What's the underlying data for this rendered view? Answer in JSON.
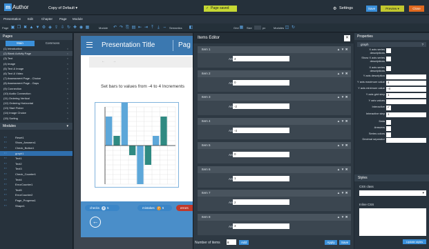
{
  "app": {
    "logo_letter": "m",
    "logo_text": "Author",
    "doc_title": "Copy of Default  ▾",
    "saved": "Page saved",
    "settings": "Settings",
    "save": "Save",
    "preview": "Preview ▾",
    "close": "Close"
  },
  "menu": [
    "Presentation",
    "Edit",
    "Chapter",
    "Page",
    "Module"
  ],
  "toolbar": {
    "page": "Page",
    "module": "Module",
    "semantics": "Semantics",
    "grid": "Grid",
    "size": "Size",
    "px": "px",
    "modules": "Modules"
  },
  "pages": {
    "title": "Pages",
    "tab_main": "Main",
    "tab_commons": "Commons",
    "items": [
      "(1) Introduction",
      "(2) Blank Activity Page",
      "(3) Text",
      "(4) Image",
      "(5) Text & Image",
      "(6) Text & Video",
      "(7) Assessment Page - Choice",
      "(8) Assessment Page - Gaps",
      "(9) Connection",
      "(10) Audio Connection",
      "(11) Ordering Vertical",
      "(12) Ordering Horizontal",
      "(13) Start Fisher",
      "(14) Image Choice",
      "(15) Sorting"
    ]
  },
  "modules": {
    "title": "Modules",
    "items": [
      "Reset1",
      "Show_Answers1",
      "Check_Button1",
      "graph1",
      "Text1",
      "Text2",
      "Text3",
      "Check_Counter1",
      "Text4",
      "ErrorCounter1",
      "Text5",
      "ErrorCounter2",
      "Page_Progress1",
      "Shape1"
    ]
  },
  "slide": {
    "title": "Presentation Title",
    "page": "Pag",
    "instruction": "Set bars to values from -4 to 4 Increments",
    "checks": "checks",
    "checks_n": "2",
    "checks_t": "5",
    "mistakes": "mistakes",
    "mistakes_n": "7",
    "mistakes_t": "5",
    "errors": "errors"
  },
  "chart_data": {
    "type": "bar",
    "categories": [
      "1",
      "2",
      "3",
      "4",
      "5",
      "6",
      "7",
      "8",
      "9"
    ],
    "values": [
      3,
      1,
      5,
      -1,
      -4,
      -2,
      1,
      3,
      0
    ],
    "ylim": [
      -4,
      4
    ],
    "colors": [
      "#5da7d9",
      "#2f8a82",
      "#5da7d9",
      "#2f8a82",
      "#5da7d9",
      "#2f8a82",
      "#5da7d9",
      "#2f8a82",
      "#5da7d9"
    ]
  },
  "editor": {
    "title": "Items Editor",
    "answer_label": "Answer",
    "items": [
      {
        "name": "Item 1",
        "answer": "4"
      },
      {
        "name": "Item 2",
        "answer": "0"
      },
      {
        "name": "Item 3",
        "answer": "-2"
      },
      {
        "name": "Item 4",
        "answer": "-4"
      },
      {
        "name": "Item 5",
        "answer": "0"
      },
      {
        "name": "Item 6",
        "answer": "1"
      },
      {
        "name": "Item 7",
        "answer": "2"
      },
      {
        "name": "Item 8",
        "answer": "3"
      }
    ],
    "number_label": "Number of items",
    "number_value": "8",
    "add": "Add",
    "apply": "Apply",
    "save": "Save"
  },
  "properties": {
    "title": "Properties",
    "module_id": "graph",
    "rows": [
      {
        "label": "X axis series descriptions",
        "kind": "check",
        "value": ""
      },
      {
        "label": "Show X axis series descriptions",
        "kind": "check",
        "value": ""
      },
      {
        "label": "X axis series descriptions",
        "kind": "check",
        "value": ""
      },
      {
        "label": "Y axis description",
        "kind": "input",
        "value": ""
      },
      {
        "label": "Y axis maximum value",
        "kind": "input",
        "value": "4"
      },
      {
        "label": "Y axis minimum value",
        "kind": "input",
        "value": "-4"
      },
      {
        "label": "Y axis grid step",
        "kind": "input",
        "value": "1"
      },
      {
        "label": "Y axis values",
        "kind": "input",
        "value": ""
      },
      {
        "label": "Interactive",
        "kind": "check",
        "value": "✓"
      },
      {
        "label": "Interactive step",
        "kind": "input",
        "value": "1"
      },
      {
        "label": "Data",
        "kind": "check",
        "value": ""
      },
      {
        "label": "Answers",
        "kind": "check",
        "value": ""
      },
      {
        "label": "Series colors",
        "kind": "check",
        "value": ""
      },
      {
        "label": "Decimal separator",
        "kind": "input",
        "value": ""
      }
    ],
    "styles": "Styles",
    "css_class": "CSS class",
    "inline_css": "Inline CSS",
    "update": "Update styles"
  }
}
